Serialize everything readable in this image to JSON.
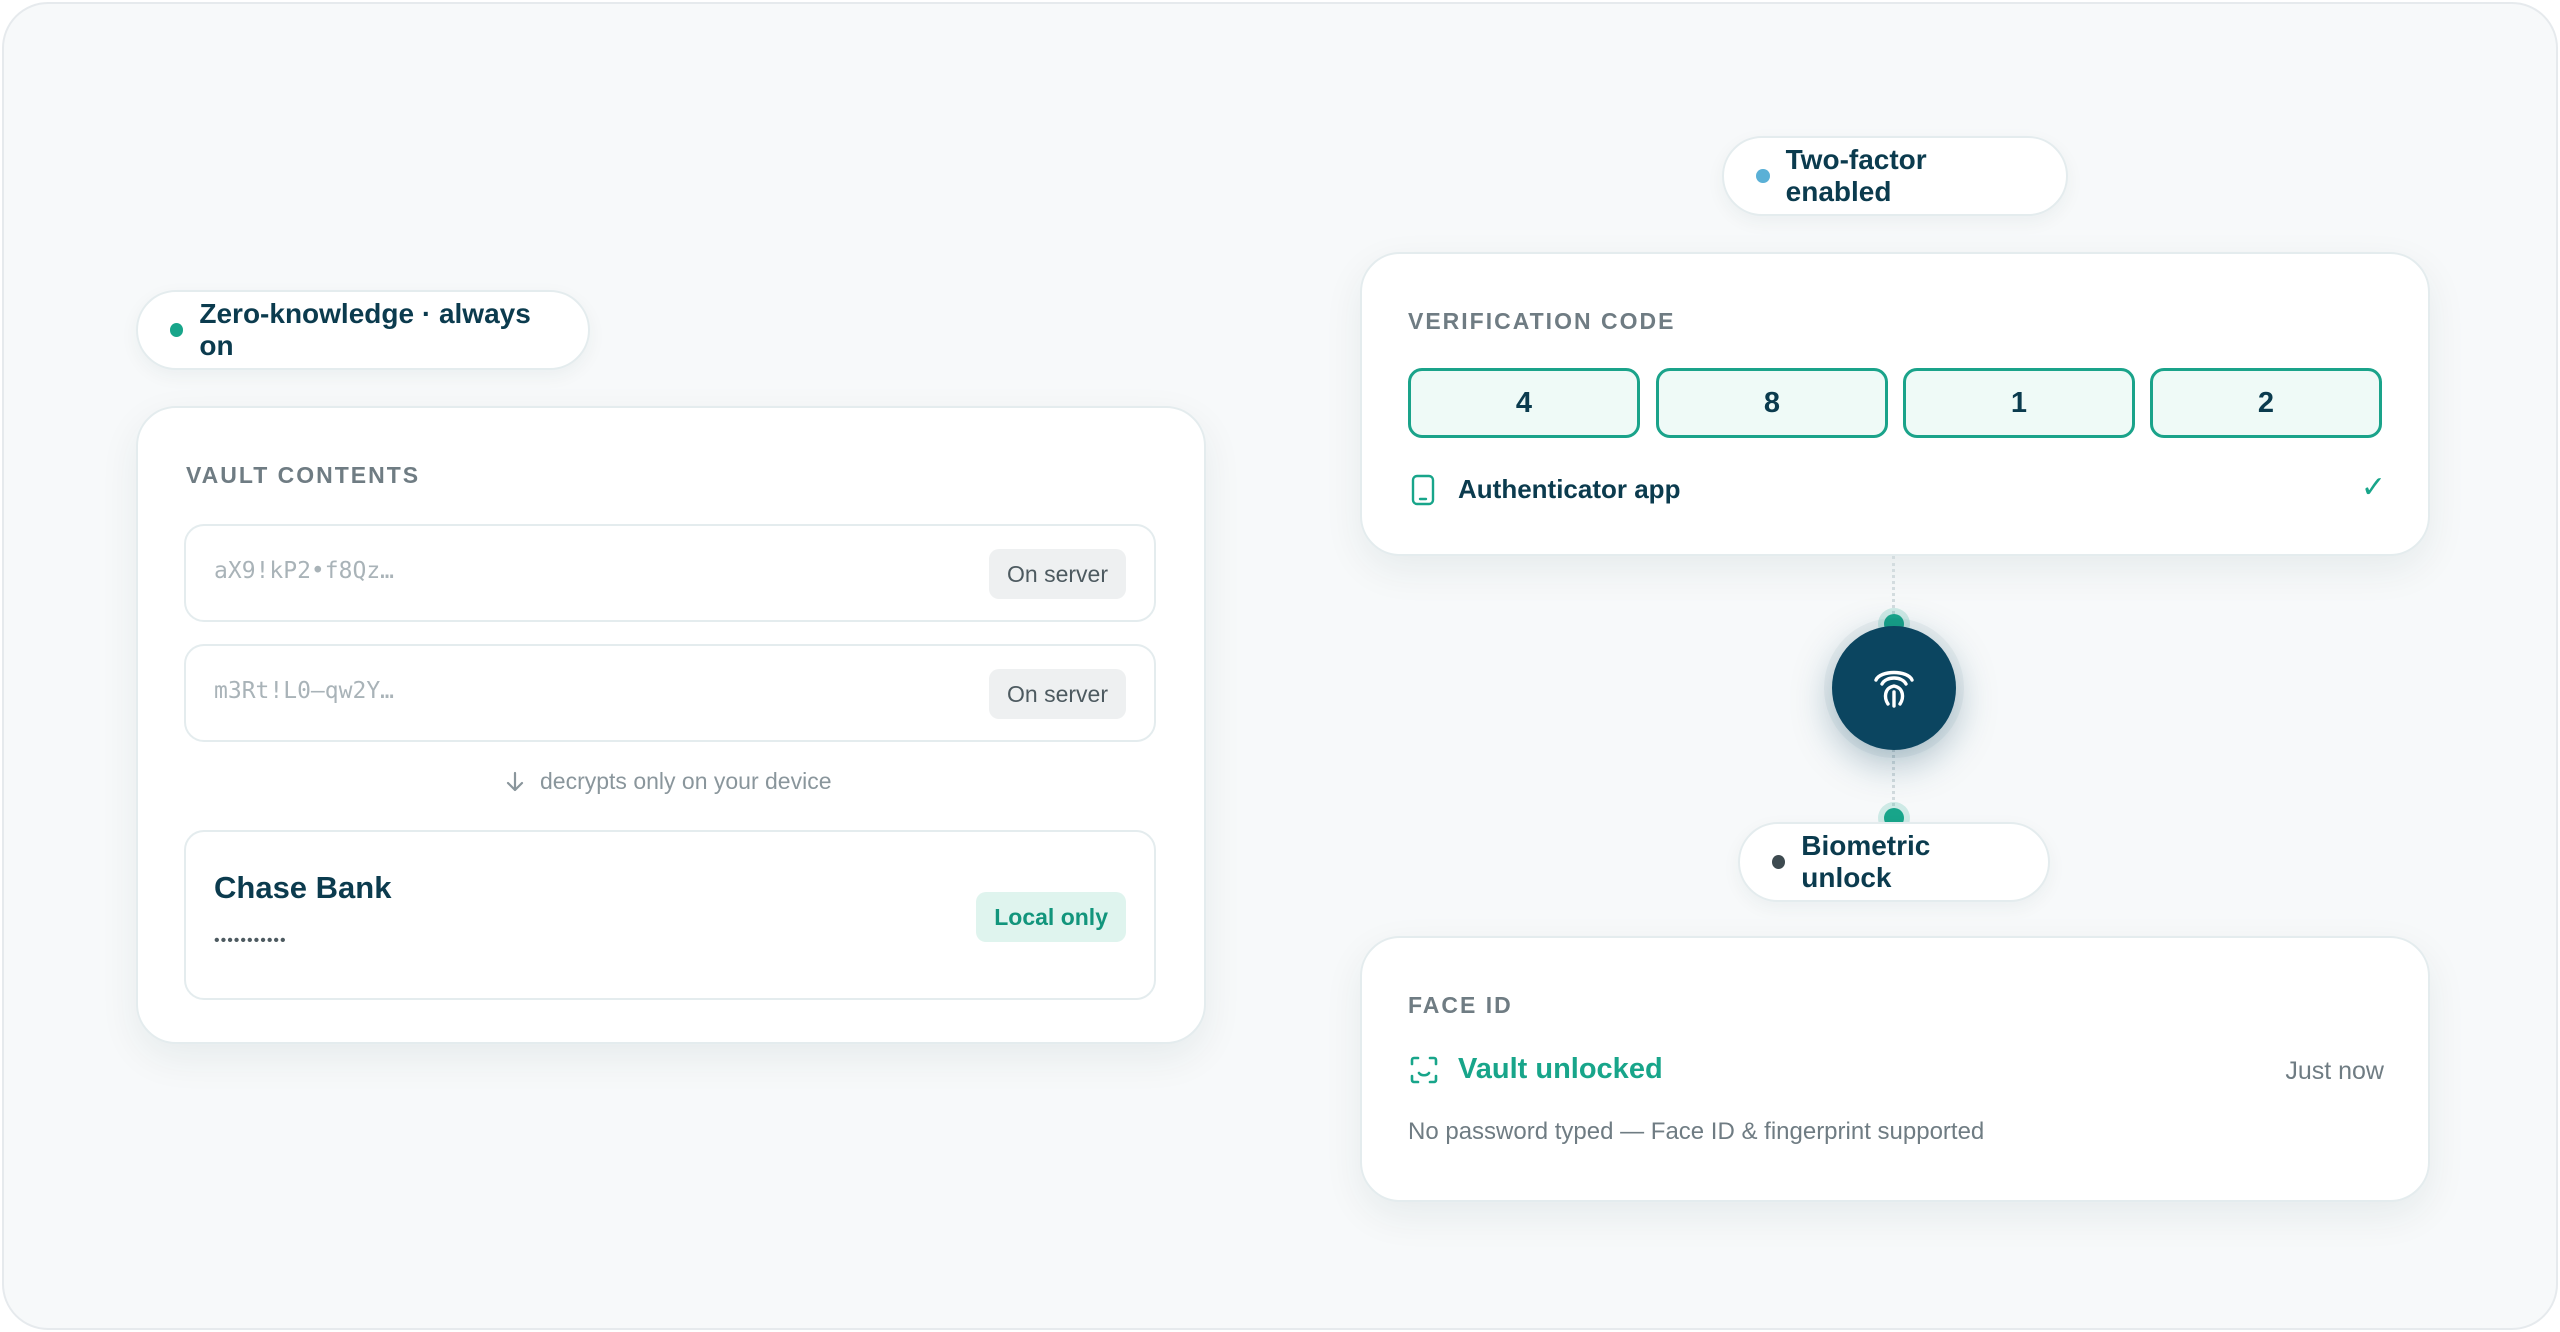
{
  "left": {
    "status_pill": {
      "label": "Zero-knowledge · always on",
      "dot_color": "#18a58a"
    },
    "vault_card": {
      "title": "VAULT CONTENTS",
      "encrypted_items": [
        {
          "cipher": "aX9!kP2•f8Qz…",
          "badge": "On server"
        },
        {
          "cipher": "m3Rt!L0—qw2Y…",
          "badge": "On server"
        }
      ],
      "hint": {
        "icon": "arrow-down-icon",
        "text": "decrypts only on your device"
      },
      "decrypted_item": {
        "name": "Chase Bank",
        "masked": "•••••••••••",
        "badge": "Local only"
      }
    }
  },
  "right": {
    "twofa_pill": {
      "label": "Two-factor enabled",
      "dot_color": "#5ab0d6"
    },
    "verification_card": {
      "title": "VERIFICATION CODE",
      "digits": [
        "4",
        "8",
        "1",
        "2"
      ],
      "method": {
        "icon": "phone-icon",
        "label": "Authenticator app",
        "check": "✓"
      }
    },
    "connector": {
      "icon": "fingerprint-icon"
    },
    "biometric_pill": {
      "label": "Biometric unlock",
      "dot_color": "#3d4a50"
    },
    "faceid_card": {
      "title": "FACE ID",
      "status": {
        "icon": "face-scan-icon",
        "label": "Vault unlocked",
        "time": "Just now"
      },
      "note": "No password typed — Face ID & fingerprint supported"
    }
  },
  "colors": {
    "accent": "#18a58a",
    "navy": "#0b3b4e",
    "node": "#0b4560"
  }
}
